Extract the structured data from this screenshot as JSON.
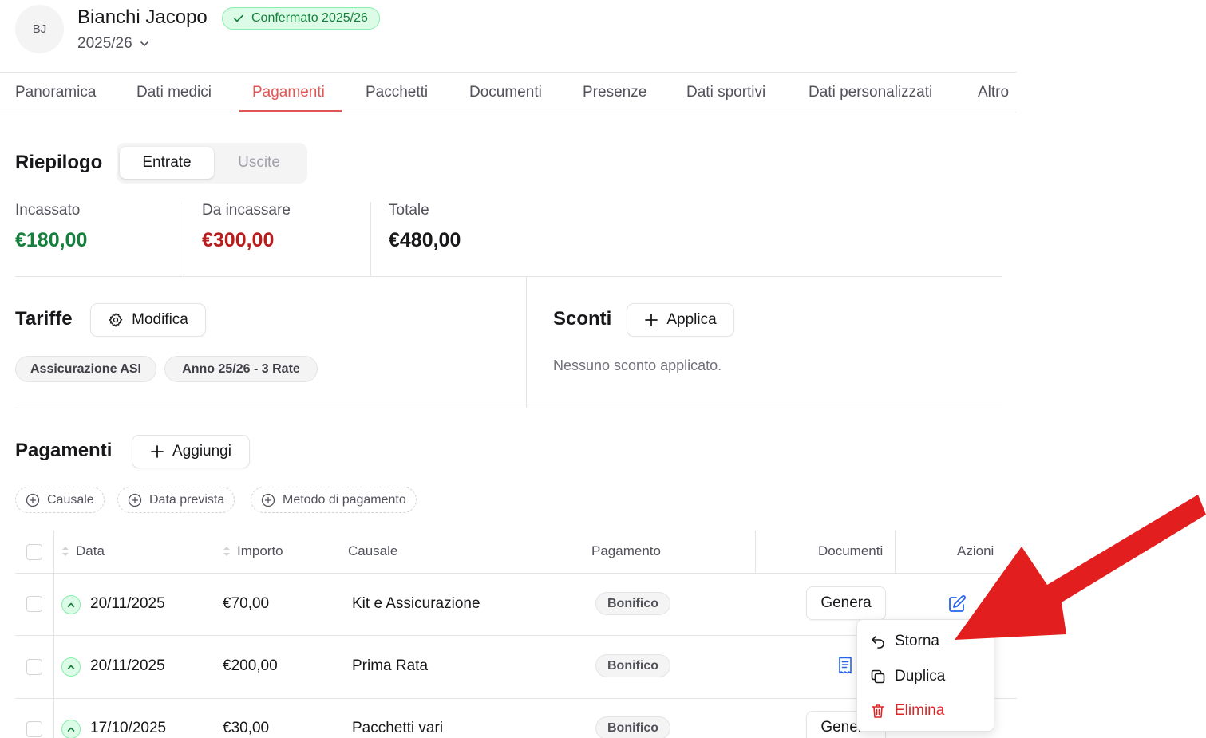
{
  "header": {
    "avatar_initials": "BJ",
    "name": "Bianchi Jacopo",
    "status_badge": "Confermato 2025/26",
    "season": "2025/26"
  },
  "tabs": [
    {
      "label": "Panoramica",
      "active": false
    },
    {
      "label": "Dati medici",
      "active": false
    },
    {
      "label": "Pagamenti",
      "active": true
    },
    {
      "label": "Pacchetti",
      "active": false
    },
    {
      "label": "Documenti",
      "active": false
    },
    {
      "label": "Presenze",
      "active": false
    },
    {
      "label": "Dati sportivi",
      "active": false
    },
    {
      "label": "Dati personalizzati",
      "active": false
    },
    {
      "label": "Altro",
      "active": false
    }
  ],
  "summary": {
    "title": "Riepilogo",
    "toggle": {
      "income": "Entrate",
      "expenses": "Uscite",
      "selected": "Entrate"
    },
    "stats": [
      {
        "label": "Incassato",
        "value": "€180,00",
        "color": "#15803d"
      },
      {
        "label": "Da incassare",
        "value": "€300,00",
        "color": "#b91c1c"
      },
      {
        "label": "Totale",
        "value": "€480,00",
        "color": "#18181b"
      }
    ]
  },
  "tariffs": {
    "title": "Tariffe",
    "edit_label": "Modifica",
    "items": [
      "Assicurazione ASI",
      "Anno 25/26 - 3 Rate"
    ]
  },
  "discounts": {
    "title": "Sconti",
    "apply_label": "Applica",
    "empty_text": "Nessuno sconto applicato."
  },
  "payments": {
    "title": "Pagamenti",
    "add_label": "Aggiungi",
    "filters": [
      "Causale",
      "Data prevista",
      "Metodo di pagamento"
    ],
    "columns": {
      "date": "Data",
      "amount": "Importo",
      "reason": "Causale",
      "payment": "Pagamento",
      "documents": "Documenti",
      "actions": "Azioni"
    },
    "rows": [
      {
        "date": "20/11/2025",
        "amount": "€70,00",
        "reason": "Kit e Assicurazione",
        "method": "Bonifico",
        "document_action": "Genera"
      },
      {
        "date": "20/11/2025",
        "amount": "€200,00",
        "reason": "Prima Rata",
        "method": "Bonifico",
        "document_action": ""
      },
      {
        "date": "17/10/2025",
        "amount": "€30,00",
        "reason": "Pacchetti vari",
        "method": "Bonifico",
        "document_action": "Genera"
      }
    ]
  },
  "action_menu": {
    "items": [
      {
        "label": "Storna",
        "icon": "undo-icon"
      },
      {
        "label": "Duplica",
        "icon": "copy-icon"
      },
      {
        "label": "Elimina",
        "icon": "trash-icon",
        "color": "#dc2626"
      }
    ]
  },
  "colors": {
    "accent": "#e25555",
    "income": "#15803d",
    "pending": "#b91c1c",
    "annotation_arrow": "#e31e1e"
  }
}
